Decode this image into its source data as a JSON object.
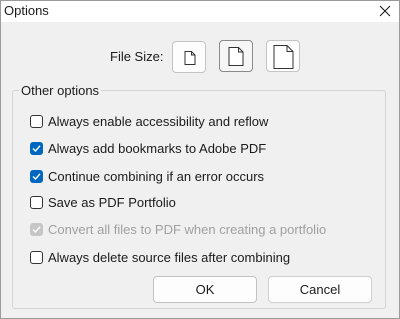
{
  "window": {
    "title": "Options",
    "close_icon": "close-icon"
  },
  "file_size": {
    "label": "File Size:",
    "options": [
      {
        "name": "small",
        "icon": "document-small-icon",
        "selected": false
      },
      {
        "name": "medium",
        "icon": "document-medium-icon",
        "selected": true
      },
      {
        "name": "large",
        "icon": "document-large-icon",
        "selected": false
      }
    ]
  },
  "other_options": {
    "title": "Other options",
    "items": [
      {
        "label": "Always enable accessibility and reflow",
        "checked": false,
        "enabled": true
      },
      {
        "label": "Always add bookmarks to Adobe PDF",
        "checked": true,
        "enabled": true
      },
      {
        "label": "Continue combining if an error occurs",
        "checked": true,
        "enabled": true
      },
      {
        "label": "Save as PDF Portfolio",
        "checked": false,
        "enabled": true
      },
      {
        "label": "Convert all files to PDF when creating a portfolio",
        "checked": true,
        "enabled": false
      },
      {
        "label": "Always delete source files after combining",
        "checked": false,
        "enabled": true
      }
    ]
  },
  "buttons": {
    "ok": "OK",
    "cancel": "Cancel"
  },
  "colors": {
    "accent": "#0067c0",
    "disabled": "#a0a0a0",
    "dialog_bg": "#f0f0f0"
  }
}
